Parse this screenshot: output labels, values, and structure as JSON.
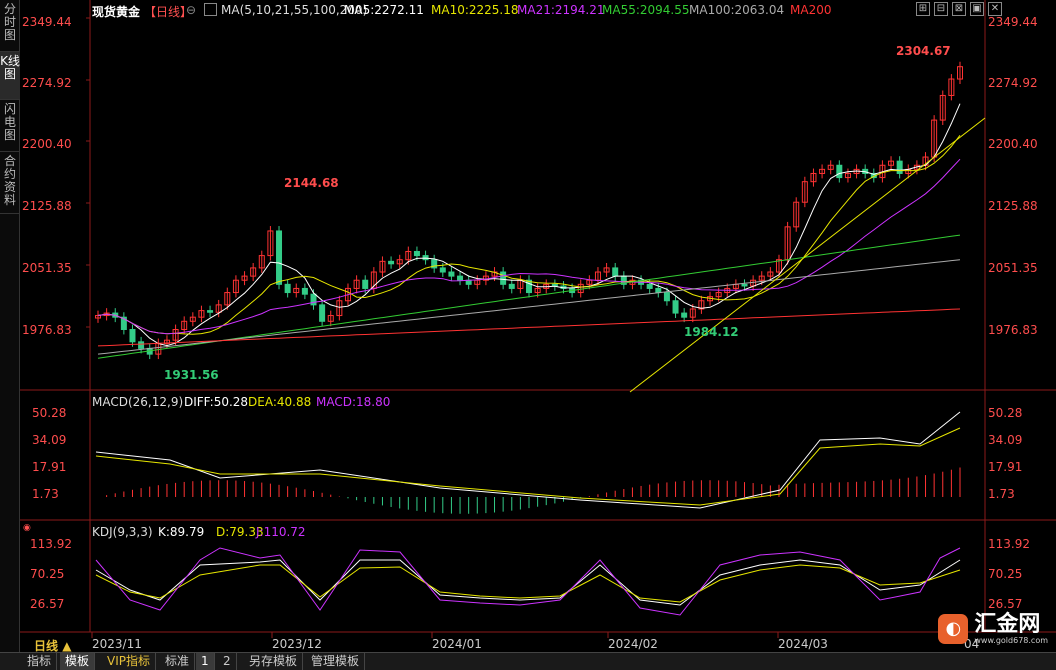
{
  "sidebar": {
    "tabs": [
      {
        "label": "分时图",
        "active": false
      },
      {
        "label": "K线图",
        "active": true
      },
      {
        "label": "闪电图",
        "active": false
      },
      {
        "label": "合约资料",
        "active": false
      }
    ]
  },
  "header": {
    "instrument": "现货黄金",
    "period_tag": "【日线】",
    "ma_label": "MA(5,10,21,55,100,200)",
    "ma_items": [
      {
        "text": "MA5:2272.11",
        "color": "#ffffff"
      },
      {
        "text": "MA10:2225.18",
        "color": "#e6e600"
      },
      {
        "text": "MA21:2194.21",
        "color": "#cc33ff"
      },
      {
        "text": "MA55:2094.55",
        "color": "#33cc33"
      },
      {
        "text": "MA100:2063.04",
        "color": "#aaaaaa"
      },
      {
        "text": "MA200",
        "color": "#ff3333"
      }
    ],
    "tool_icons": [
      "grid-icon",
      "shrink-icon",
      "expand-icon",
      "settings-icon",
      "close-icon"
    ]
  },
  "price_axis": [
    "2349.44",
    "2274.92",
    "2200.40",
    "2125.88",
    "2051.35",
    "1976.83"
  ],
  "annotations": {
    "high_1": "2144.68",
    "low_1": "1931.56",
    "low_2": "1984.12",
    "high_2": "2304.67"
  },
  "macd": {
    "label": "MACD(26,12,9)",
    "items": [
      {
        "text": "DIFF:50.28",
        "color": "#ffffff"
      },
      {
        "text": "DEA:40.88",
        "color": "#e6e600"
      },
      {
        "text": "MACD:18.80",
        "color": "#cc33ff"
      }
    ],
    "axis": [
      "50.28",
      "34.09",
      "17.91",
      "1.73"
    ]
  },
  "kdj": {
    "label": "KDJ(9,3,3)",
    "items": [
      {
        "text": "K:89.79",
        "color": "#ffffff"
      },
      {
        "text": "D:79.33",
        "color": "#e6e600"
      },
      {
        "text": "J:110.72",
        "color": "#cc33ff"
      }
    ],
    "axis": [
      "113.92",
      "70.25",
      "26.57"
    ]
  },
  "time_axis": {
    "period": "日线",
    "dates": [
      "2023/11",
      "2023/12",
      "2024/01",
      "2024/02",
      "2024/03",
      "04"
    ]
  },
  "bottom_tabs": [
    {
      "label": "指标",
      "active": false,
      "vip": false
    },
    {
      "label": "模板",
      "active": true,
      "vip": false
    },
    {
      "label": "VIP指标",
      "active": false,
      "vip": true
    },
    {
      "label": "标准",
      "active": false,
      "vip": false
    },
    {
      "label": "1",
      "active": true,
      "vip": false
    },
    {
      "label": "2",
      "active": false,
      "vip": false
    },
    {
      "label": "另存模板",
      "active": false,
      "vip": false
    },
    {
      "label": "管理模板",
      "active": false,
      "vip": false
    }
  ],
  "logo": {
    "brand": "汇金网",
    "url": "www.gold678.com",
    "mark_icon": "gold-logo-icon"
  },
  "colors": {
    "up": "#ff3333",
    "down": "#33cc88",
    "axis_label": "#ff4d4d",
    "green_label": "#33cc77"
  }
}
